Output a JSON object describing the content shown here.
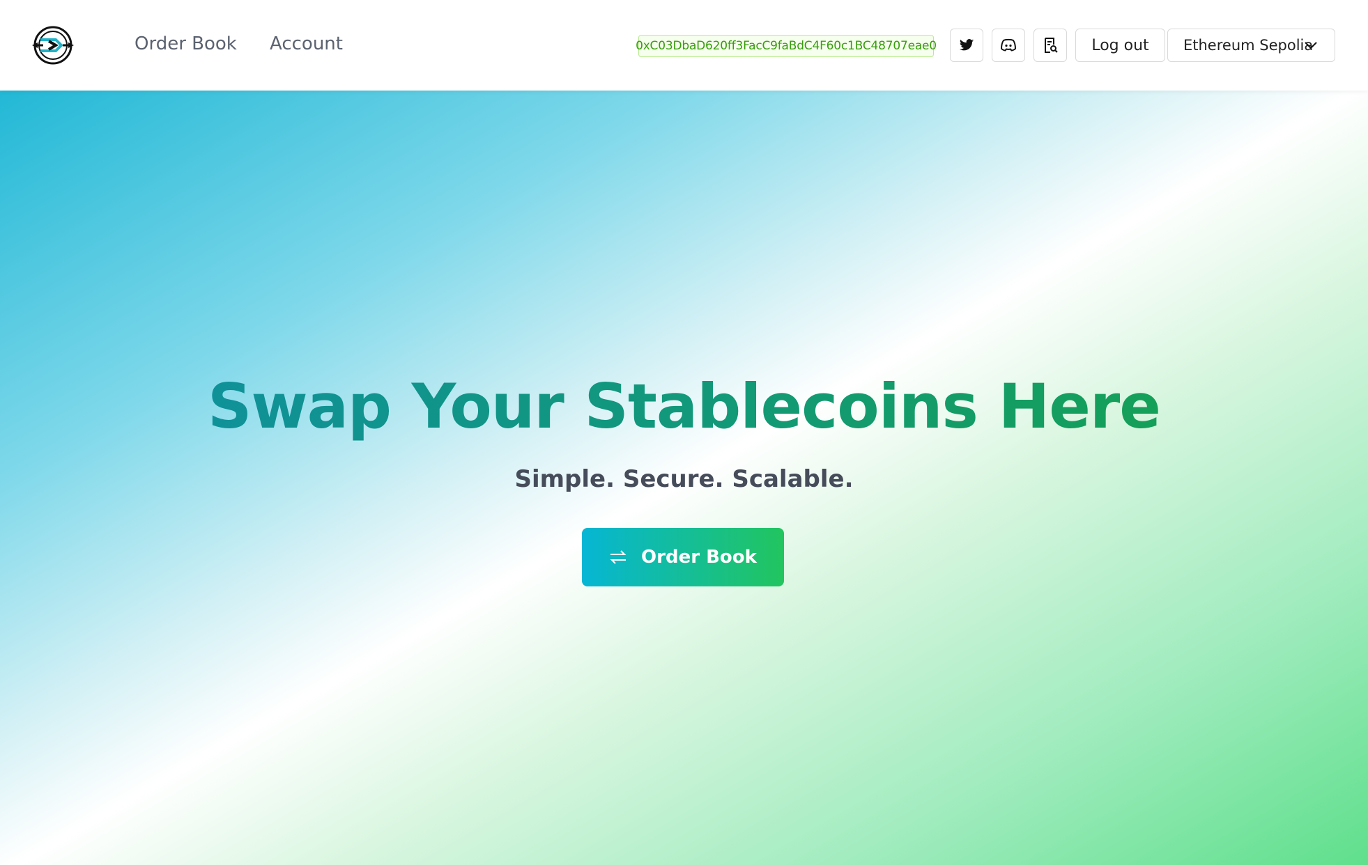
{
  "nav": {
    "logo": "exchange-logo",
    "links": [
      "Order Book",
      "Account"
    ]
  },
  "header": {
    "wallet_address": "0xC03DbaD620ff3FacC9faBdC4F60c1BC48707eae0",
    "icons": [
      "twitter-icon",
      "discord-icon",
      "docs-search-icon"
    ],
    "logout_label": "Log out",
    "network": "Ethereum Sepolia"
  },
  "hero": {
    "title": "Swap Your Stablecoins Here",
    "subtitle": "Simple. Secure. Scalable.",
    "cta_label": "Order Book",
    "cta_icon": "swap-arrows-icon"
  },
  "colors": {
    "wallet_text": "#389e0d",
    "wallet_bg": "#f6ffed",
    "cta_start": "#06b6d4",
    "cta_end": "#22c55e",
    "title_start": "#0e8ea6",
    "title_end": "#16a34a"
  }
}
